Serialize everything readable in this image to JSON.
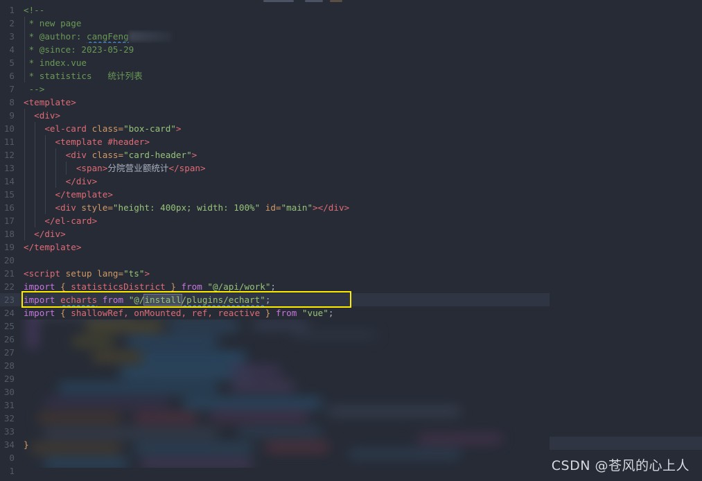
{
  "editor": {
    "theme_bg": "#262b36",
    "line_highlight": "#2f3542",
    "gutter_color": "#545b68",
    "annotation_color": "#ffed00",
    "selection_color": "#454d5c",
    "squiggle_color": "#4a8fd4",
    "language": "vue",
    "first_visible_line": 1,
    "last_visible_line": 34,
    "active_line": 23
  },
  "lines": [
    {
      "num": "1",
      "text": "<!--"
    },
    {
      "num": "2",
      "text": " * new page"
    },
    {
      "num": "3",
      "text": " * @author: cangFeng"
    },
    {
      "num": "4",
      "text": " * @since: 2023-05-29"
    },
    {
      "num": "5",
      "text": " * index.vue"
    },
    {
      "num": "6",
      "text": " * statistics   统计列表"
    },
    {
      "num": "7",
      "text": " -->"
    },
    {
      "num": "8",
      "text": "<template>"
    },
    {
      "num": "9",
      "text": "  <div>"
    },
    {
      "num": "10",
      "text": "    <el-card class=\"box-card\">"
    },
    {
      "num": "11",
      "text": "      <template #header>"
    },
    {
      "num": "12",
      "text": "        <div class=\"card-header\">"
    },
    {
      "num": "13",
      "text": "          <span>分院营业额统计</span>"
    },
    {
      "num": "14",
      "text": "        </div>"
    },
    {
      "num": "15",
      "text": "      </template>"
    },
    {
      "num": "16",
      "text": "      <div style=\"height: 400px; width: 100%\" id=\"main\"></div>"
    },
    {
      "num": "17",
      "text": "    </el-card>"
    },
    {
      "num": "18",
      "text": "  </div>"
    },
    {
      "num": "19",
      "text": "</template>"
    },
    {
      "num": "20",
      "text": ""
    },
    {
      "num": "21",
      "text": "<script setup lang=\"ts\">"
    },
    {
      "num": "22",
      "text": "import { statisticsDistrict } from \"@/api/work\";"
    },
    {
      "num": "23",
      "text": "import echarts from \"@/install/plugins/echart\";"
    },
    {
      "num": "24",
      "text": "import { shallowRef, onMounted, ref, reactive } from \"vue\";"
    }
  ],
  "line_numbers_blurred": [
    "25",
    "26",
    "27",
    "28",
    "29",
    "30",
    "31",
    "32",
    "33",
    "34",
    "0",
    "1"
  ],
  "comment_block": {
    "open": "<!--",
    "new_page": " * new page",
    "author_label": " * @author: ",
    "author_value": "cangFeng",
    "since_label": " * @since: ",
    "since_value": "2023-05-29",
    "file": " * index.vue",
    "statistics": " * statistics   统计列表",
    "close": " -->"
  },
  "template_block": {
    "template_open": "<template>",
    "div_open": "  <div>",
    "elcard_open_tag": "    <el-card ",
    "elcard_attr": "class=",
    "elcard_value": "\"box-card\"",
    "header_template": "      <template #header>",
    "card_header_tag": "        <div ",
    "card_header_attr": "class=",
    "card_header_value": "\"card-header\"",
    "span_open": "          <span>",
    "span_text": "分院营业额统计",
    "span_close": "</span>",
    "div_close_1": "        </div>",
    "template_close_inner": "      </template>",
    "main_div_tag": "      <div ",
    "main_style_attr": "style=",
    "main_style_value": "\"height: 400px; width: 100%\"",
    "main_id_attr": " id=",
    "main_id_value": "\"main\"",
    "main_div_close": "></div>",
    "elcard_close": "    </el-card>",
    "div_close_2": "  </div>",
    "template_close": "</template>"
  },
  "script_block": {
    "script_open_tag": "<script ",
    "script_setup": "setup ",
    "script_lang_attr": "lang=",
    "script_lang_value": "\"ts\"",
    "script_open_end": ">",
    "import_kw": "import",
    "brace_open": " { ",
    "brace_close": " } ",
    "from_kw": "from",
    "semi": ";",
    "line22_named": "statisticsDistrict",
    "line22_module": "\"@/api/work\"",
    "line23_default": "echarts",
    "line23_module_pre": "\"@/",
    "line23_module_sel": "install",
    "line23_module_post": "/plugins/echart\"",
    "line24_named": "shallowRef, onMounted, ref, reactive",
    "line24_module": "\"vue\"",
    "closing_brace": "}"
  },
  "annotation": {
    "type": "rectangle-highlight",
    "target_line": 23,
    "color": "#ffed00"
  },
  "watermark": {
    "text": "CSDN @苍风的心上人"
  }
}
